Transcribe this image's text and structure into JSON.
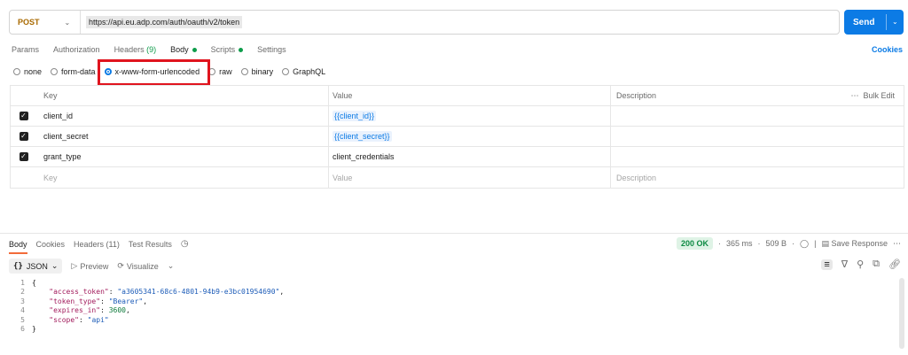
{
  "request": {
    "method": "POST",
    "url": "https://api.eu.adp.com/auth/oauth/v2/token",
    "send_label": "Send"
  },
  "tabs": [
    {
      "label": "Params"
    },
    {
      "label": "Authorization"
    },
    {
      "label": "Headers",
      "count": "(9)"
    },
    {
      "label": "Body"
    },
    {
      "label": "Scripts"
    },
    {
      "label": "Settings"
    }
  ],
  "cookies_label": "Cookies",
  "body_types": [
    "none",
    "form-data",
    "x-www-form-urlencoded",
    "raw",
    "binary",
    "GraphQL"
  ],
  "selected_body_type": "x-www-form-urlencoded",
  "params_table": {
    "headers": {
      "key": "Key",
      "value": "Value",
      "description": "Description",
      "bulk_edit": "Bulk Edit"
    },
    "rows": [
      {
        "key": "client_id",
        "value": "{{client_id}}",
        "checked": true
      },
      {
        "key": "client_secret",
        "value": "{{client_secret}}",
        "checked": true
      },
      {
        "key": "grant_type",
        "value": "client_credentials",
        "checked": true
      }
    ],
    "placeholder": {
      "key": "Key",
      "value": "Value",
      "description": "Description"
    }
  },
  "response": {
    "tabs": [
      {
        "label": "Body"
      },
      {
        "label": "Cookies"
      },
      {
        "label": "Headers (11)"
      },
      {
        "label": "Test Results"
      }
    ],
    "status": "200 OK",
    "time": "365 ms",
    "size": "509 B",
    "save_label": "Save Response",
    "format": "JSON",
    "preview_label": "Preview",
    "visualize_label": "Visualize",
    "lines": [
      {
        "n": "1",
        "text": "{"
      },
      {
        "n": "2",
        "key": "\"access_token\"",
        "value": "\"a3605341-68c6-4801-94b9-e3bc01954690\"",
        "tail": ","
      },
      {
        "n": "3",
        "key": "\"token_type\"",
        "value": "\"Bearer\"",
        "tail": ","
      },
      {
        "n": "4",
        "key": "\"expires_in\"",
        "value": "3600",
        "tail": ","
      },
      {
        "n": "5",
        "key": "\"scope\"",
        "value": "\"api\"",
        "tail": ""
      },
      {
        "n": "6",
        "text": "}"
      }
    ]
  }
}
